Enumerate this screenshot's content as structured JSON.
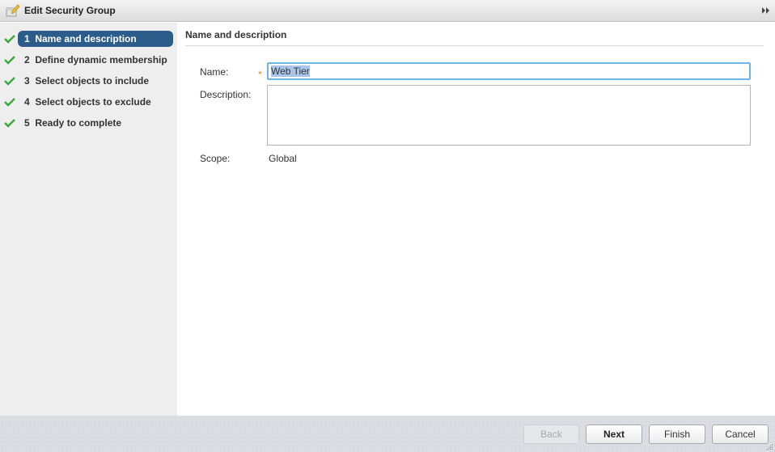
{
  "window": {
    "title": "Edit Security Group",
    "title_icon": "edit-group-icon",
    "expand_icon": "double-chevron-right-icon"
  },
  "steps": [
    {
      "number": "1",
      "label": "Name and description",
      "completed": true,
      "active": true
    },
    {
      "number": "2",
      "label": "Define dynamic membership",
      "completed": true,
      "active": false
    },
    {
      "number": "3",
      "label": "Select objects to include",
      "completed": true,
      "active": false
    },
    {
      "number": "4",
      "label": "Select objects to exclude",
      "completed": true,
      "active": false
    },
    {
      "number": "5",
      "label": "Ready to complete",
      "completed": true,
      "active": false
    }
  ],
  "steps_display": [
    "1  Name and description",
    "2  Define dynamic membership",
    "3  Select objects to include",
    "4  Select objects to exclude",
    "5  Ready to complete"
  ],
  "form": {
    "section_title": "Name and description",
    "name_label": "Name:",
    "name_value": "Web Tier",
    "name_required": "*",
    "description_label": "Description:",
    "description_value": "",
    "scope_label": "Scope:",
    "scope_value": "Global"
  },
  "footer": {
    "back_label": "Back",
    "next_label": "Next",
    "finish_label": "Finish",
    "cancel_label": "Cancel",
    "back_disabled": true
  },
  "colors": {
    "active_step": "#2b5c8a",
    "check": "#3aa83a",
    "focus_border": "#6fb6e8",
    "required": "#e08a1e"
  }
}
